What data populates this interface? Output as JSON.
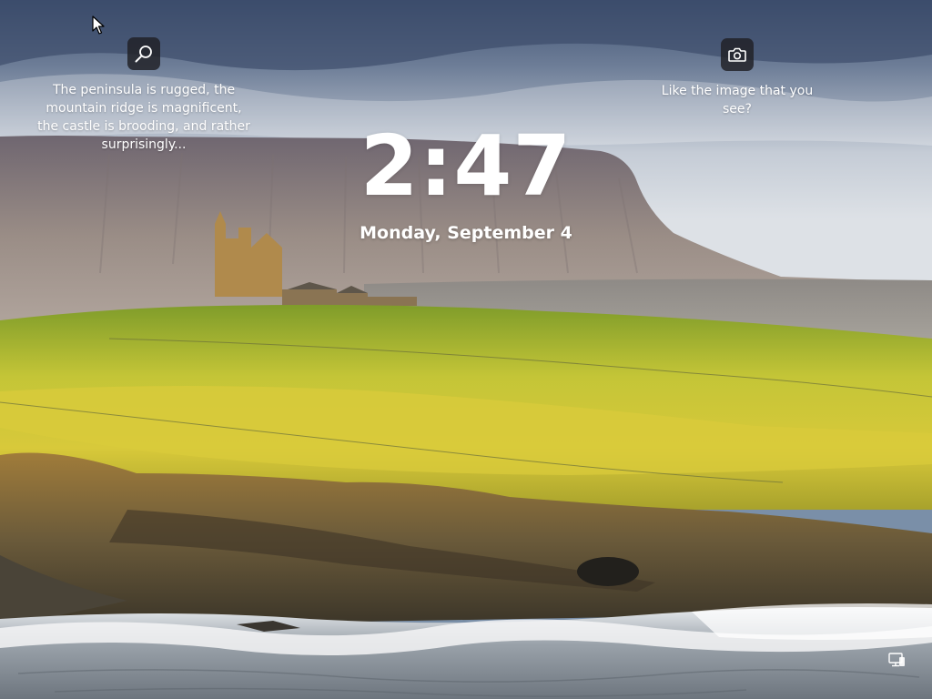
{
  "lock_screen": {
    "time": "2:47",
    "date": "Monday, September 4"
  },
  "spotlight": {
    "info": {
      "icon": "search-icon",
      "description": "The peninsula is rugged, the mountain ridge is magnificent, the castle is brooding, and rather surprisingly..."
    },
    "like": {
      "icon": "camera-icon",
      "prompt": "Like the image that you see?"
    }
  },
  "system_tray": {
    "icon": "network-icon"
  },
  "colors": {
    "sky_top": "#4a5d7e",
    "sky_bottom": "#e6e8ec",
    "mountain": "#8e857e",
    "grass": "#c9c63a",
    "cliff": "#6a5a3a",
    "sea": "#b8bec4",
    "button_bg": "#202024"
  }
}
